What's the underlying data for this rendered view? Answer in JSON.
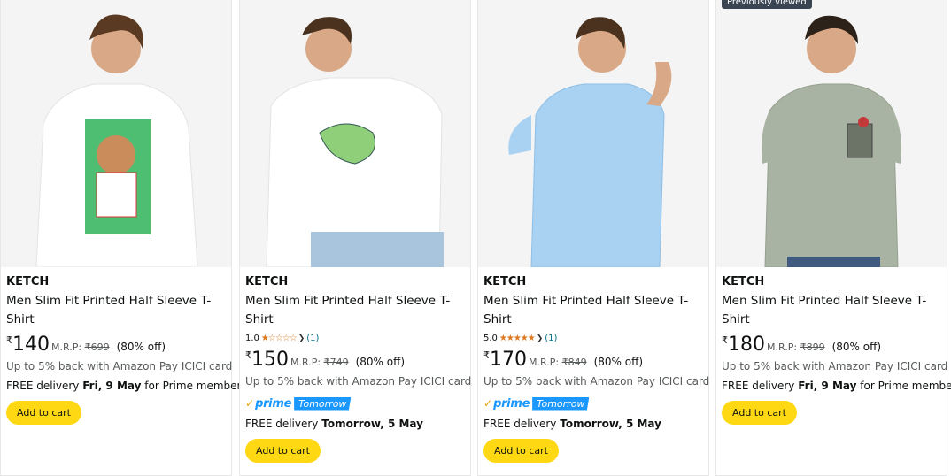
{
  "cards": [
    {
      "brand": "KETCH",
      "title": "Men Slim Fit Printed Half Sleeve T-Shirt",
      "currency": "₹",
      "price": "140",
      "mrp_label": "M.R.P:",
      "mrp": "₹699",
      "discount": "(80% off)",
      "cashback": "Up to 5% back with Amazon Pay ICICI card",
      "delivery_prefix": "FREE delivery ",
      "delivery_date": "Fri, 9 May",
      "delivery_suffix": " for Prime members",
      "add_to_cart": "Add to cart",
      "shirt_color": "#ffffff"
    },
    {
      "brand": "KETCH",
      "title": "Men Slim Fit Printed Half Sleeve T-Shirt",
      "rating_value": "1.0",
      "rating_count": "(1)",
      "currency": "₹",
      "price": "150",
      "mrp_label": "M.R.P:",
      "mrp": "₹749",
      "discount": "(80% off)",
      "cashback": "Up to 5% back with Amazon Pay ICICI card",
      "prime_label": "prime",
      "prime_tag": "Tomorrow",
      "delivery_prefix": "FREE delivery ",
      "delivery_date": "Tomorrow, 5 May",
      "add_to_cart": "Add to cart",
      "shirt_color": "#ffffff"
    },
    {
      "brand": "KETCH",
      "title": "Men Slim Fit Printed Half Sleeve T-Shirt",
      "rating_value": "5.0",
      "rating_count": "(1)",
      "currency": "₹",
      "price": "170",
      "mrp_label": "M.R.P:",
      "mrp": "₹849",
      "discount": "(80% off)",
      "cashback": "Up to 5% back with Amazon Pay ICICI card",
      "prime_label": "prime",
      "prime_tag": "Tomorrow",
      "delivery_prefix": "FREE delivery ",
      "delivery_date": "Tomorrow, 5 May",
      "add_to_cart": "Add to cart",
      "shirt_color": "#a9d1f2"
    },
    {
      "badge": "Previously viewed",
      "brand": "KETCH",
      "title": "Men Slim Fit Printed Half Sleeve T-Shirt",
      "currency": "₹",
      "price": "180",
      "mrp_label": "M.R.P:",
      "mrp": "₹899",
      "discount": "(80% off)",
      "cashback": "Up to 5% back with Amazon Pay ICICI card",
      "delivery_prefix": "FREE delivery ",
      "delivery_date": "Fri, 9 May",
      "delivery_suffix": " for Prime members",
      "add_to_cart": "Add to cart",
      "shirt_color": "#a9b3a3"
    }
  ]
}
